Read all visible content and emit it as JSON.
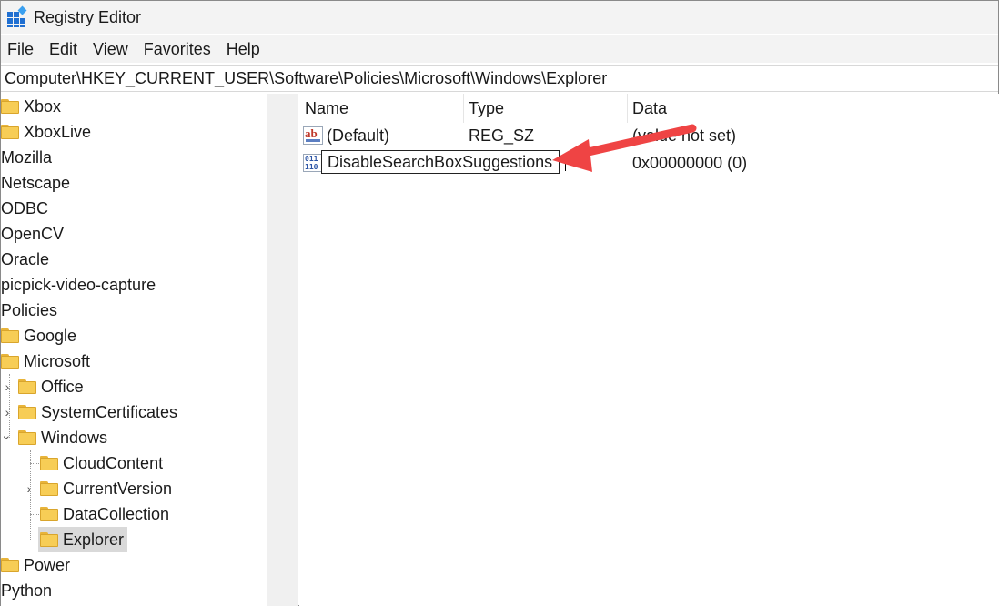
{
  "window": {
    "title": "Registry Editor"
  },
  "menu": [
    {
      "key": "F",
      "rest": "ile"
    },
    {
      "key": "E",
      "rest": "dit"
    },
    {
      "key": "V",
      "rest": "iew"
    },
    {
      "key": "F",
      "rest": "avorites",
      "first_plain": "",
      "display": "Favorites"
    },
    {
      "key": "H",
      "rest": "elp"
    }
  ],
  "address": "Computer\\HKEY_CURRENT_USER\\Software\\Policies\\Microsoft\\Windows\\Explorer",
  "tree": {
    "xbox": "Xbox",
    "xboxlive": "XboxLive",
    "mozilla": "Mozilla",
    "netscape": "Netscape",
    "odbc": "ODBC",
    "opencv": "OpenCV",
    "oracle": "Oracle",
    "picpick": "picpick-video-capture",
    "policies": "Policies",
    "google": "Google",
    "microsoft": "Microsoft",
    "office": "Office",
    "systemcertificates": "SystemCertificates",
    "windows": "Windows",
    "cloudcontent": "CloudContent",
    "currentversion": "CurrentVersion",
    "datacollection": "DataCollection",
    "explorer": "Explorer",
    "power": "Power",
    "python": "Python"
  },
  "columns": {
    "name": "Name",
    "type": "Type",
    "data": "Data"
  },
  "values": [
    {
      "name": "(Default)",
      "type": "REG_SZ",
      "data": "(value not set)",
      "icon": "string-value-icon"
    },
    {
      "name": "DisableSearchBoxSuggestions",
      "type": "",
      "data": "0x00000000 (0)",
      "icon": "binary-value-icon"
    }
  ],
  "annotation": {
    "arrow_color": "#ef4444"
  },
  "colors": {
    "accent": "#1f6fd1",
    "folder": "#f7cd56",
    "selected": "#d9d9d9"
  }
}
